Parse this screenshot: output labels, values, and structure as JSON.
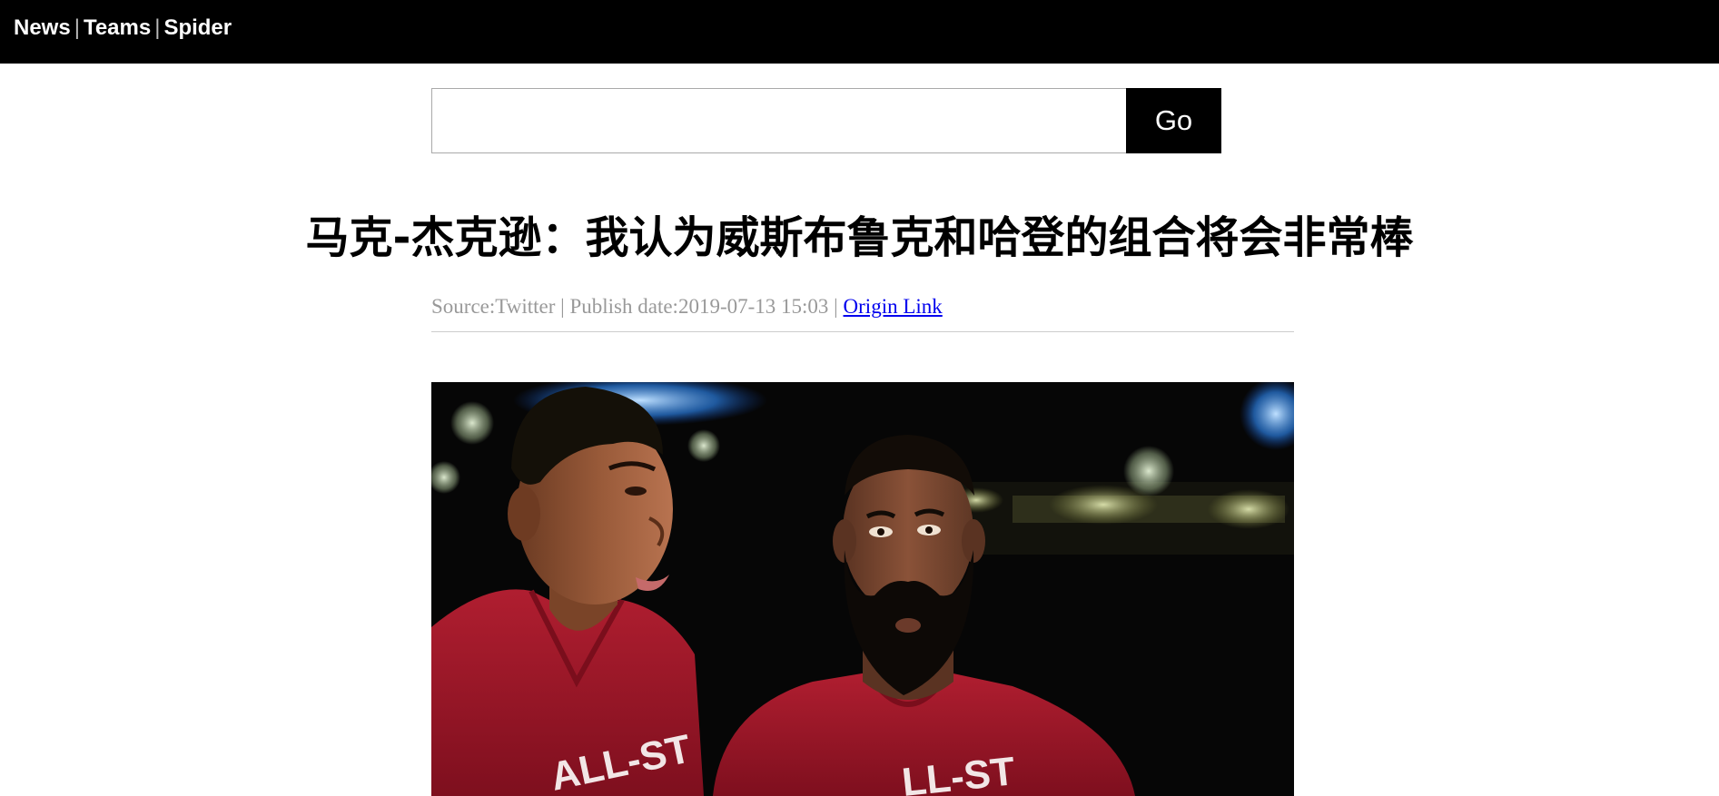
{
  "nav": {
    "items": [
      {
        "label": "News"
      },
      {
        "label": "Teams"
      },
      {
        "label": "Spider"
      }
    ],
    "separator": "|"
  },
  "search": {
    "value": "",
    "button_label": "Go"
  },
  "article": {
    "title": "马克-杰克逊：我认为威斯布鲁克和哈登的组合将会非常棒",
    "source_label": "Source:",
    "source": "Twitter",
    "publish_label": "Publish date:",
    "publish_date": "2019-07-13 15:03",
    "origin_link_label": "Origin Link",
    "separator": "|"
  },
  "photo": {
    "description_icon": "photo-two-players"
  },
  "colors": {
    "topbar": "#000000",
    "link": "#0000ee",
    "meta_text": "#999999",
    "jersey": "#a3182a"
  }
}
